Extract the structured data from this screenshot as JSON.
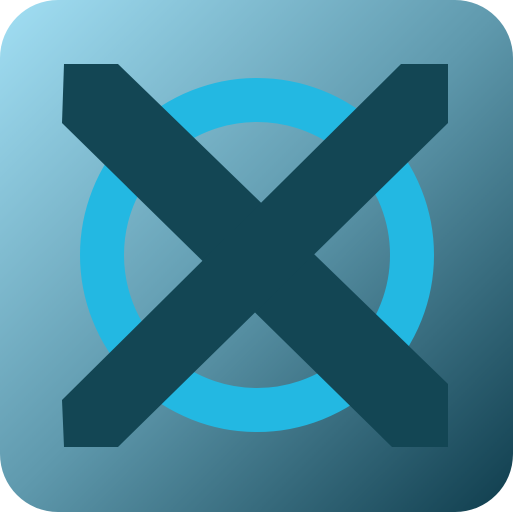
{
  "app_icon": {
    "icon_name": "x-over-ring-app-icon",
    "colors": {
      "background_gradient_start": "#a2dff4",
      "background_gradient_mid": "#5f99ad",
      "background_gradient_end": "#0f3d4d",
      "ring": "#23b8e2",
      "cross": "#134654"
    }
  }
}
